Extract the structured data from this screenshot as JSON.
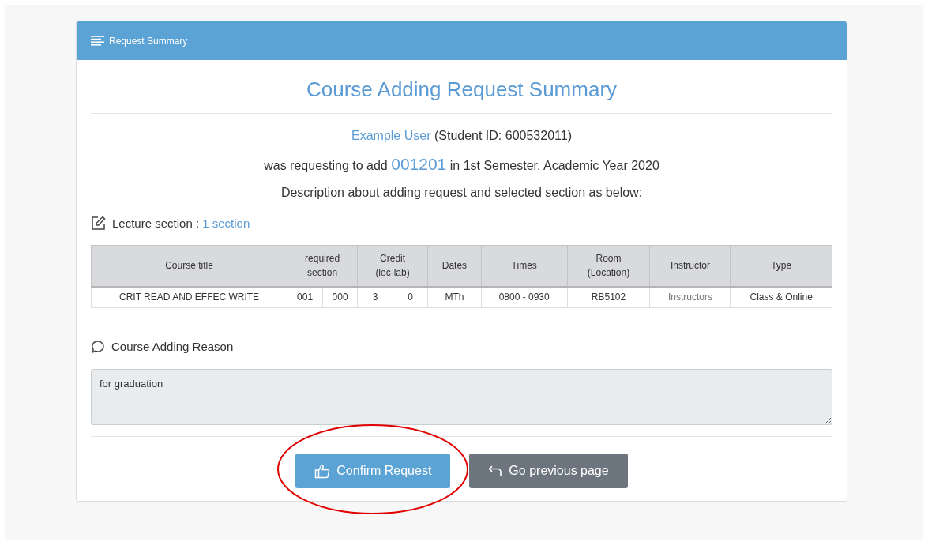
{
  "header": {
    "title": "Request Summary"
  },
  "summary": {
    "title": "Course Adding Request Summary",
    "user": "Example User",
    "user_suffix": "(Student ID: 600532011)",
    "request_prefix": "was requesting to add",
    "course_code": "001201",
    "request_suffix": "in 1st Semester, Academic Year 2020",
    "description": "Description about adding request and selected section as below:"
  },
  "lecture": {
    "label": "Lecture section :",
    "count": "1 section"
  },
  "table": {
    "columns": [
      "Course title",
      "required section",
      "Credit (lec-lab)",
      "Dates",
      "Times",
      "Room (Location)",
      "Instructor",
      "Type"
    ],
    "rows": [
      {
        "cells": [
          {
            "text": "CRIT READ AND EFFEC WRITE",
            "kind": "text"
          },
          {
            "parts": [
              "001",
              "000"
            ],
            "kind": "pair"
          },
          {
            "parts": [
              "3",
              "0"
            ],
            "kind": "pair"
          },
          {
            "text": "MTh",
            "kind": "text"
          },
          {
            "text": "0800 - 0930",
            "kind": "text"
          },
          {
            "text": "RB5102",
            "kind": "text"
          },
          {
            "text": "Instructors",
            "kind": "link"
          },
          {
            "text": "Class & Online",
            "kind": "text"
          }
        ]
      }
    ]
  },
  "reason": {
    "label": "Course Adding Reason",
    "value": "for graduation"
  },
  "buttons": [
    {
      "label": "Confirm Request",
      "kind": "confirm",
      "circled": true
    },
    {
      "label": "Go previous page",
      "kind": "back",
      "circled": false
    }
  ]
}
